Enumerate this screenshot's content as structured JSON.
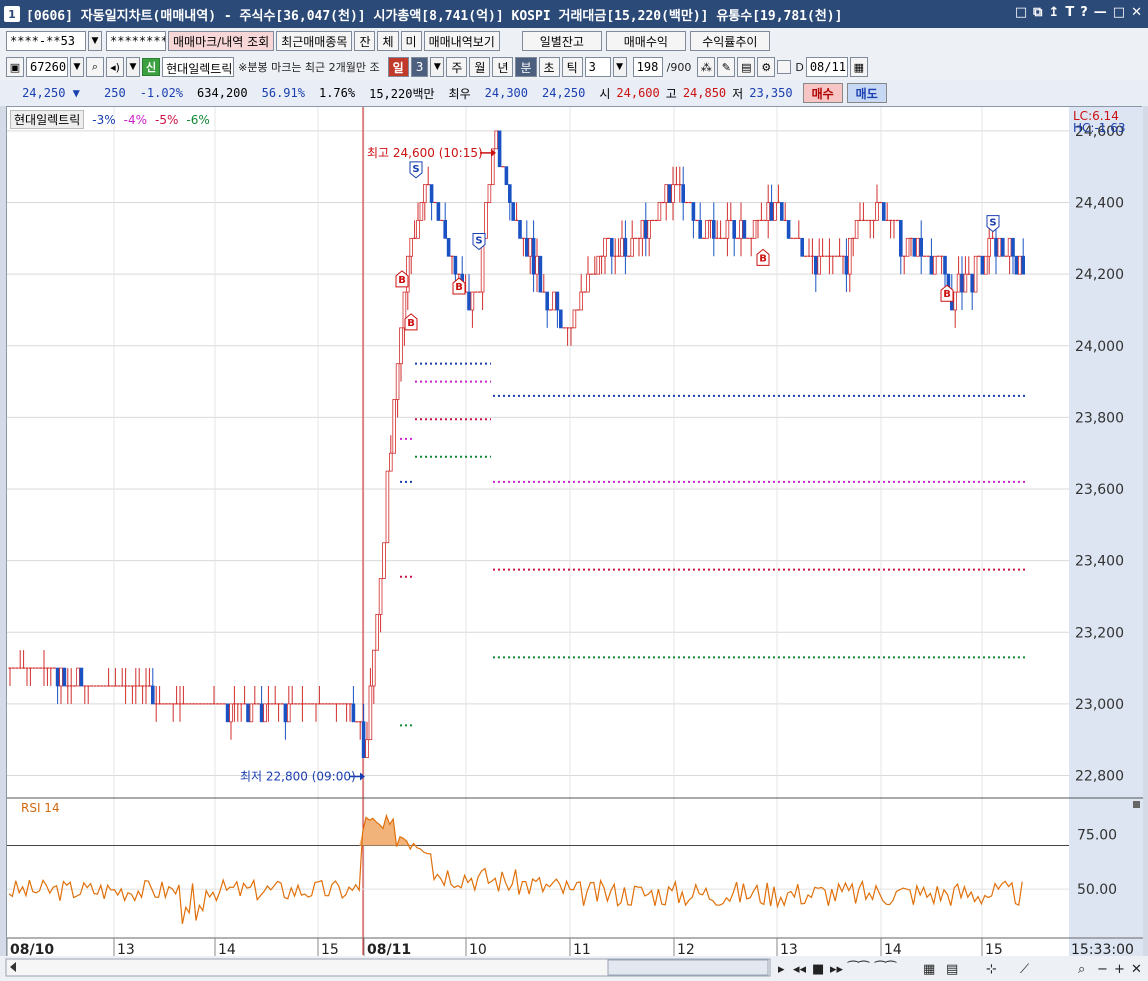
{
  "window": {
    "badge": "1",
    "title": "[0606] 자동일지차트(매매내역) - 주식수[36,047(천)] 시가총액[8,741(억)] KOSPI 거래대금[15,220(백만)] 유통수[19,781(천)]",
    "icons": [
      "□",
      "⧉",
      "↥",
      "T",
      "?",
      "—",
      "□",
      "✕"
    ]
  },
  "toolbar1": {
    "account": "****-**53",
    "password": "********",
    "buttons": [
      "매매마크/내역 조회",
      "최근매매종목",
      "잔",
      "체",
      "미",
      "매매내역보기",
      "일별잔고",
      "매매수익",
      "수익률추이"
    ]
  },
  "toolbar2": {
    "code": "67260",
    "chip": "신",
    "stock_name": "현대일렉트릭",
    "note": "※분봉 마크는 최근 2개월만 조",
    "period_buttons": [
      "일",
      "3",
      "주",
      "월",
      "년",
      "분",
      "초",
      "틱"
    ],
    "interval": "3",
    "count": "198",
    "total": "/900",
    "day_label": "D",
    "date": "08/11"
  },
  "quote": {
    "price": "24,250",
    "arrow": "▼",
    "change": "250",
    "change_pct": "-1.02%",
    "volume": "634,200",
    "vol_ratio": "56.91%",
    "turnover": "1.76%",
    "amount": "15,220백만",
    "best_label": "최우",
    "ask": "24,300",
    "bid": "24,250",
    "open_label": "시",
    "open": "24,600",
    "high_label": "고",
    "high": "24,850",
    "low_label": "저",
    "low": "23,350",
    "buy_label": "매수",
    "sell_label": "매도"
  },
  "chart_data": {
    "type": "candlestick",
    "legend": [
      "현대일렉트릭",
      "-3%",
      "-4%",
      "-5%",
      "-6%"
    ],
    "legend_colors": [
      "#333333",
      "#1a3fb0",
      "#cc22cc",
      "#cc1144",
      "#118833"
    ],
    "up_color": "#d12c2c",
    "down_color": "#1a52c4",
    "y_ticks": [
      22800,
      23000,
      23200,
      23400,
      23600,
      23800,
      24000,
      24200,
      24400,
      24600
    ],
    "y_tick_labels": [
      "22,800",
      "23,000",
      "23,200",
      "23,400",
      "23,600",
      "23,800",
      "24,000",
      "24,200",
      "24,400",
      "24,600"
    ],
    "ylim": [
      22740,
      24650
    ],
    "x_tick_labels": [
      "08/10",
      "13",
      "14",
      "15",
      "08/11",
      "10",
      "11",
      "12",
      "13",
      "14",
      "15"
    ],
    "time_label": "15:33:00",
    "lc_label": "LC:6.14",
    "hc_label": "HC:-1.63",
    "high_annotation": "최고 24,600 (10:15)",
    "low_annotation": "최저 22,800 (09:00)",
    "stop_levels": [
      {
        "pct": "-3%",
        "price": 23860,
        "color": "#1a3fb0"
      },
      {
        "pct": "-4%",
        "price": 23620,
        "color": "#cc22cc"
      },
      {
        "pct": "-5%",
        "price": 23375,
        "color": "#cc1144"
      },
      {
        "pct": "-6%",
        "price": 23130,
        "color": "#118833"
      }
    ],
    "marks": [
      {
        "type": "B",
        "price": 24170
      },
      {
        "type": "B",
        "price": 24050
      },
      {
        "type": "S",
        "price": 24480
      },
      {
        "type": "B",
        "price": 24150
      },
      {
        "type": "S",
        "price": 24280
      },
      {
        "type": "B",
        "price": 24230
      },
      {
        "type": "B",
        "price": 24130
      },
      {
        "type": "S",
        "price": 24330
      }
    ],
    "rsi": {
      "label": "RSI 14",
      "ticks": [
        "75.00",
        "50.00"
      ],
      "tick_values": [
        75,
        50
      ],
      "ylim": [
        28,
        90
      ]
    }
  }
}
